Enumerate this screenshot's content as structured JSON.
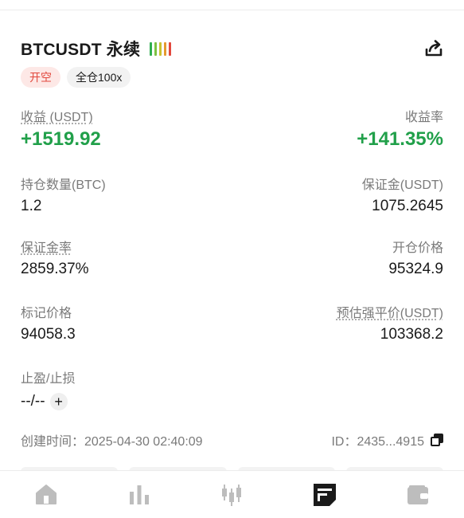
{
  "position": {
    "title": "BTCUSDT 永续",
    "strength_colors": [
      "#2fae4f",
      "#7cc242",
      "#c9c230",
      "#e59a2f",
      "#e2483d"
    ],
    "side_tag": "开空",
    "margin_tag": "全仓100x",
    "share_icon": "share-icon"
  },
  "stats": {
    "pnl_label": "收益 (USDT)",
    "pnl_value": "+1519.92",
    "roe_label": "收益率",
    "roe_value": "+141.35%",
    "size_label": "持仓数量(BTC)",
    "size_value": "1.2",
    "margin_label": "保证金(USDT)",
    "margin_value": "1075.2645",
    "margin_ratio_label": "保证金率",
    "margin_ratio_value": "2859.37%",
    "entry_label": "开仓价格",
    "entry_value": "95324.9",
    "mark_label": "标记价格",
    "mark_value": "94058.3",
    "liq_label": "预估强平价(USDT)",
    "liq_value": "103368.2",
    "tpsl_label": "止盈/止损",
    "tpsl_value": "--/--",
    "tpsl_add": "+"
  },
  "meta": {
    "created": "创建时间：2025-04-30 02:40:09",
    "id": "ID：2435...4915"
  },
  "accent": {
    "profit": "#21a04a",
    "short": "#e2483d"
  },
  "tabbar": {
    "items": [
      "home-icon",
      "bar-chart-icon",
      "candlestick-icon",
      "futures-icon",
      "wallet-icon"
    ],
    "active_index": 3
  }
}
